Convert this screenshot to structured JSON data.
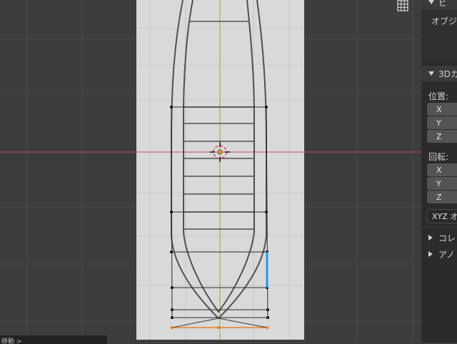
{
  "viewport": {
    "grid_toggle_icon": "grid-icon"
  },
  "panel": {
    "top_header_label": "ビ",
    "object_label": "オブジ",
    "section_3d_cursor": "3Dカ",
    "location_label": "位置:",
    "location_axes": [
      "X",
      "Y",
      "Z"
    ],
    "rotation_label": "回転:",
    "rotation_axes": [
      "X",
      "Y",
      "Z"
    ],
    "rotation_mode": "XYZ オ",
    "collections_label": "コレ",
    "annotations_label": "アノ"
  },
  "status_bar": {
    "operator_label": "移動 >"
  },
  "colors": {
    "viewport_bg": "#3d3d3d",
    "reference_image_bg": "#d9d9d9",
    "x_axis": "#c3485a",
    "y_axis": "#8ab03a",
    "selection_blue": "#1a9cf0",
    "selection_orange": "#e8801a"
  }
}
